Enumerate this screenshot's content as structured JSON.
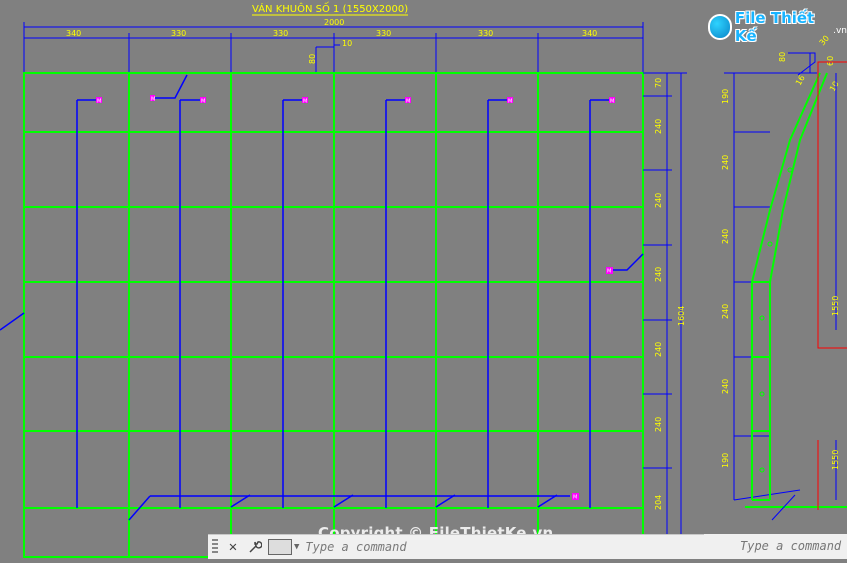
{
  "drawing": {
    "title": "VÁN KHUÔN SỐ 1 (1550X2000)",
    "overall_width_label": "2000",
    "column_width_labels": [
      "340",
      "330",
      "330",
      "330",
      "330",
      "340"
    ],
    "small_dim_labels": [
      "10",
      "80"
    ],
    "right_height_labels": [
      "70",
      "240",
      "240",
      "240",
      "240",
      "240",
      "240",
      "204"
    ],
    "total_height_label": "1604",
    "side_view_height_labels": [
      "190",
      "240",
      "240",
      "240",
      "240",
      "190"
    ],
    "side_view_top_labels": [
      "80",
      "60",
      "30"
    ],
    "side_view_right_labels": [
      "1550",
      "1550"
    ],
    "side_view_diag_labels": [
      "16",
      "10"
    ],
    "marker_text": "M"
  },
  "command_line": {
    "placeholder": "Type a command",
    "right_placeholder": "Type a command"
  },
  "watermark": {
    "top_brand": "File Thiết Kế",
    "top_domain": ".vn",
    "bottom_text": "Copyright © FileThietKe.vn"
  },
  "colors": {
    "background": "#808080",
    "frame": "#00ff00",
    "rebar": "#0000ff",
    "dimension": "#0000ff",
    "text": "#ffff00",
    "marker": "#ff00ff",
    "section": "#ff0000"
  },
  "icons": {
    "close": "close-icon",
    "wrench": "wrench-icon",
    "prompt": "command-prompt-icon"
  }
}
